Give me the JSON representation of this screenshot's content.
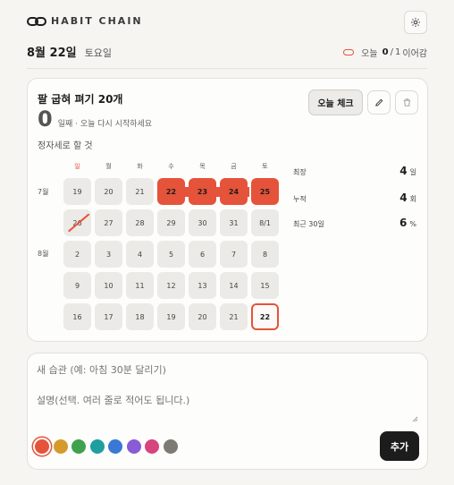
{
  "app": {
    "title": "HABIT CHAIN"
  },
  "date": {
    "main": "8월 22일",
    "day": "토요일"
  },
  "streak": {
    "prefix": "오늘",
    "done": "0",
    "sep": "/",
    "total": "1",
    "suffix": "이어감"
  },
  "habit": {
    "title": "팔 굽혀 펴기 20개",
    "count": "0",
    "count_sub": "일째 · 오늘 다시 시작하세요",
    "description": "정자세로 할 것",
    "check_label": "오늘 체크",
    "weekdays": [
      "일",
      "월",
      "화",
      "수",
      "목",
      "금",
      "토"
    ],
    "months": [
      {
        "label": "7월"
      },
      {
        "label": "8월"
      }
    ],
    "calendar": [
      [
        {
          "label": "19",
          "state": "empty"
        },
        {
          "label": "20",
          "state": "empty"
        },
        {
          "label": "21",
          "state": "empty"
        },
        {
          "label": "22",
          "state": "done"
        },
        {
          "label": "23",
          "state": "done"
        },
        {
          "label": "24",
          "state": "done"
        },
        {
          "label": "25",
          "state": "done"
        }
      ],
      [
        {
          "label": "26",
          "state": "crossed"
        },
        {
          "label": "27",
          "state": "empty"
        },
        {
          "label": "28",
          "state": "empty"
        },
        {
          "label": "29",
          "state": "empty"
        },
        {
          "label": "30",
          "state": "empty"
        },
        {
          "label": "31",
          "state": "empty"
        },
        {
          "label": "8/1",
          "state": "empty"
        }
      ],
      [
        {
          "label": "2",
          "state": "empty"
        },
        {
          "label": "3",
          "state": "empty"
        },
        {
          "label": "4",
          "state": "empty"
        },
        {
          "label": "5",
          "state": "empty"
        },
        {
          "label": "6",
          "state": "empty"
        },
        {
          "label": "7",
          "state": "empty"
        },
        {
          "label": "8",
          "state": "empty"
        }
      ],
      [
        {
          "label": "9",
          "state": "empty"
        },
        {
          "label": "10",
          "state": "empty"
        },
        {
          "label": "11",
          "state": "empty"
        },
        {
          "label": "12",
          "state": "empty"
        },
        {
          "label": "13",
          "state": "empty"
        },
        {
          "label": "14",
          "state": "empty"
        },
        {
          "label": "15",
          "state": "empty"
        }
      ],
      [
        {
          "label": "16",
          "state": "empty"
        },
        {
          "label": "17",
          "state": "empty"
        },
        {
          "label": "18",
          "state": "empty"
        },
        {
          "label": "19",
          "state": "empty"
        },
        {
          "label": "20",
          "state": "empty"
        },
        {
          "label": "21",
          "state": "empty"
        },
        {
          "label": "22",
          "state": "today"
        }
      ]
    ],
    "stats": [
      {
        "label": "최장",
        "value": "4",
        "unit": "일"
      },
      {
        "label": "누적",
        "value": "4",
        "unit": "회"
      },
      {
        "label": "최근 30일",
        "value": "6",
        "unit": "%"
      }
    ]
  },
  "new_habit": {
    "name_placeholder": "새 습관 (예: 아침 30분 달리기)",
    "desc_placeholder": "설명(선택. 여러 줄로 적어도 됩니다.)",
    "add_label": "추가",
    "colors": [
      "#e5533a",
      "#d59a2c",
      "#3fa14d",
      "#1f9ea0",
      "#3a78d6",
      "#8a5bd6",
      "#d6457d",
      "#7d7a74"
    ],
    "selected_color": "#e5533a"
  },
  "icons": {
    "settings": "gear-icon",
    "edit": "pencil-icon",
    "delete": "trash-icon",
    "logo": "chain-link-icon"
  }
}
